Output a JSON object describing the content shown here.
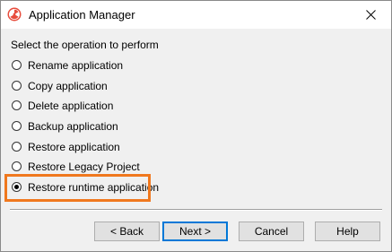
{
  "window": {
    "title": "Application Manager",
    "icon": "radiation-icon",
    "close_icon": "close-icon"
  },
  "prompt": "Select the operation to perform",
  "options": [
    {
      "label": "Rename application",
      "selected": false
    },
    {
      "label": "Copy application",
      "selected": false
    },
    {
      "label": "Delete application",
      "selected": false
    },
    {
      "label": "Backup application",
      "selected": false
    },
    {
      "label": "Restore application",
      "selected": false
    },
    {
      "label": "Restore Legacy Project",
      "selected": false
    },
    {
      "label": "Restore runtime application",
      "selected": true
    }
  ],
  "buttons": {
    "back": "< Back",
    "next": "Next >",
    "cancel": "Cancel",
    "help": "Help"
  },
  "colors": {
    "highlight": "#f0781e",
    "icon_red": "#e74c3c",
    "default_button_border": "#0078d7"
  }
}
